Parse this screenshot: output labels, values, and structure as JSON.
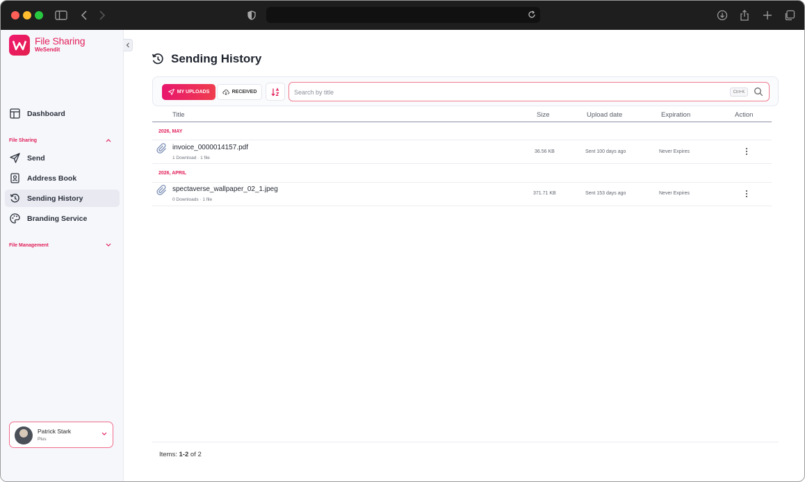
{
  "brand": {
    "title": "File Sharing",
    "subtitle": "WeSendit",
    "accent": "#e21f5a"
  },
  "sidebar": {
    "dashboard": "Dashboard",
    "section_file_sharing": "File Sharing",
    "items": [
      {
        "label": "Send",
        "icon": "send-icon"
      },
      {
        "label": "Address Book",
        "icon": "address-book-icon"
      },
      {
        "label": "Sending History",
        "icon": "history-icon",
        "active": true
      },
      {
        "label": "Branding Service",
        "icon": "palette-icon"
      }
    ],
    "section_file_management": "File Management"
  },
  "user": {
    "name": "Patrick Stark",
    "plan": "Plus"
  },
  "page": {
    "title": "Sending History"
  },
  "filters": {
    "tab_uploads": "MY UPLOADS",
    "tab_received": "RECEIVED",
    "search_placeholder": "Search by title",
    "shortcut": "Ctrl+K"
  },
  "table": {
    "columns": {
      "title": "Title",
      "size": "Size",
      "upload_date": "Upload date",
      "expiration": "Expiration",
      "action": "Action"
    },
    "groups": [
      {
        "label": "2026, MAY",
        "rows": [
          {
            "name": "invoice_0000014157.pdf",
            "meta": "1 Download · 1 file",
            "size": "36.56 KB",
            "uploaded": "Sent 100 days ago",
            "expiration": "Never Expires"
          }
        ]
      },
      {
        "label": "2026, APRIL",
        "rows": [
          {
            "name": "spectaverse_wallpaper_02_1.jpeg",
            "meta": "0 Downloads · 1 file",
            "size": "371.71 KB",
            "uploaded": "Sent 153 days ago",
            "expiration": "Never Expires"
          }
        ]
      }
    ]
  },
  "footer": {
    "prefix": "Items: ",
    "range": "1-2",
    "suffix": " of 2"
  }
}
